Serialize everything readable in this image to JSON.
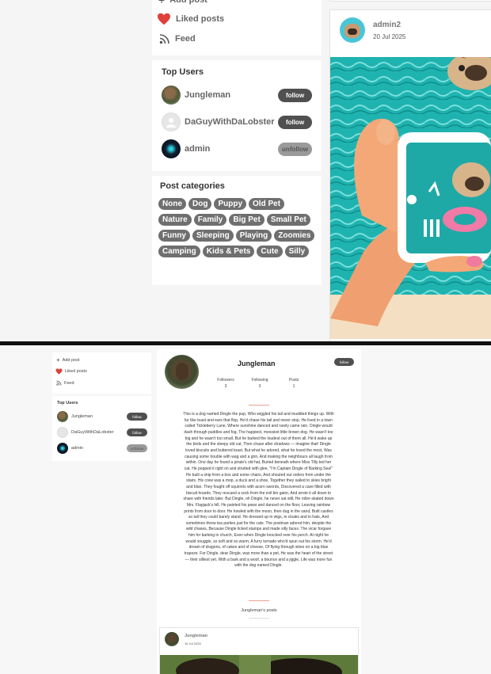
{
  "sidebar": {
    "add_post": "Add post",
    "liked_posts": "Liked posts",
    "feed": "Feed"
  },
  "top_users": {
    "heading": "Top Users",
    "users": [
      {
        "name": "Jungleman",
        "action": "follow"
      },
      {
        "name": "DaGuyWithDaLobster",
        "action": "follow"
      },
      {
        "name": "admin",
        "action": "unfollow"
      }
    ]
  },
  "categories": {
    "heading": "Post categories",
    "items": [
      "None",
      "Dog",
      "Puppy",
      "Old Pet",
      "Nature",
      "Family",
      "Big Pet",
      "Small Pet",
      "Funny",
      "Sleeping",
      "Playing",
      "Zoomies",
      "Camping",
      "Kids & Pets",
      "Cute",
      "Silly"
    ]
  },
  "post": {
    "author": "admin2",
    "date": "20 Jul 2025"
  },
  "profile": {
    "name": "Jungleman",
    "follow_label": "follow",
    "stats": [
      {
        "label": "Followers",
        "value": "3"
      },
      {
        "label": "Following",
        "value": "3"
      },
      {
        "label": "Posts",
        "value": "1"
      }
    ],
    "bio_lines": [
      "This is a dog named Dingle the pup, Who wiggled his tail and muddied things up. With",
      "fur like toast and ears that flop, He'd chase his tail and never stop. He lived in a town",
      "called Tickleberry Lane, Where sunshine danced and rarely came rain. Dingle would",
      "dash through puddles and fog, The happiest, messiest little brown dog. He wasn't too",
      "big and he wasn't too small, But he barked the loudest out of them all. He'd wake up",
      "the birds and the sleepy old cat, Then chase after shadows — imagine that! Dingle",
      "loved biscuits and buttered toast, But what he adored, what he loved the most, Was",
      "causing some trouble with wag and a grin, And making the neighbours all laugh from",
      "within. One day he found a pirate's old hat, Buried beneath where Miss Tilly ted her",
      "cat. He popped it right on and strutted with glee, \"I'm Captain Dingle of Barking Sea!\"",
      "He built a ship from a box and some chairs, And shouted out orders from under the",
      "stairs. His crew was a mop, a duck and a shoe, Together they sailed to skies bright",
      "and blue. They fought off squirrels with acorn swords, Discovered a cave filled with",
      "biscuit hoards. They rescued a sock from the evil bin gator, And wrote it all down to",
      "share with friends later. But Dingle, oh Dingle, he never sat still, He roller-skated down",
      "Mrs. Flapjack's hill. He painted his paws and danced on the floor, Leaving rainbow",
      "prints from door to door. He howled with the moon, then dug in the sand, Built castles",
      "so tall they could barely stand. He dressed up in wigs, in cloaks and in hats, And",
      "sometimes threw tea parties just for the cats. The postman adored him, despite the",
      "wild chases, Because Dingle licked stamps and made silly faces. The vicar forgave",
      "him for barking in church, Even when Dingle knocked over his perch. At night he",
      "would snuggle, so soft and so warm, A furry tornado who'd spun out his storm. He'd",
      "dream of dragons, of cakes and of cheese, Of flying through skies on a big blue",
      "trapeze. For Dingle, dear Dingle, was more than a pet, He was the heart of the street",
      "— their silliest yet. With a bark and a woof, a bounce and a jiggle, Life was more fun",
      "with the dog named Dingle."
    ],
    "posts_heading": "Jungleman's posts",
    "post_author": "Jungleman",
    "post_date": "16 Jul 2025"
  },
  "colors": {
    "button_dark": "#505050",
    "button_unfollow": "#9a9a9a",
    "heart": "#e0403a",
    "accent_line": "#f0a090",
    "sea": "#1fb3b0"
  }
}
